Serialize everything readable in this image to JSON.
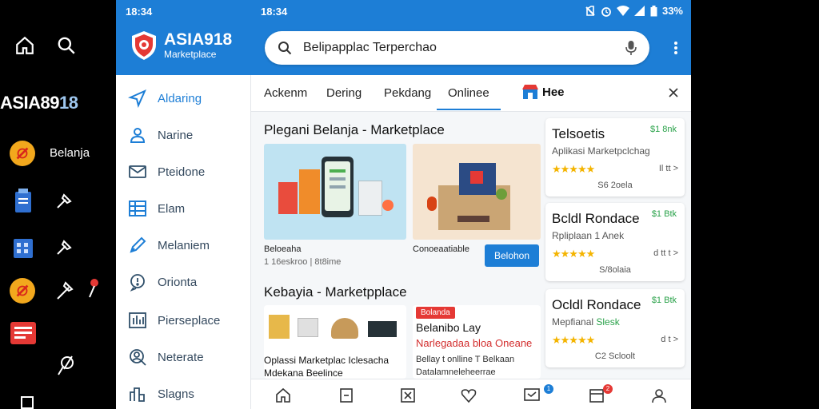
{
  "left_panel": {
    "logo_text_prefix": "ASIA89",
    "logo_text_num": "18",
    "belanja_label": "Belanja"
  },
  "statusbar": {
    "time_left": "18:34",
    "time_right": "18:34",
    "battery": "33%"
  },
  "brand": {
    "name": "ASIA918",
    "sub": "Marketplace"
  },
  "search": {
    "text": "Belipapplac Terperchao"
  },
  "sidebar": {
    "items": [
      {
        "label": "Aldaring",
        "icon": "send-icon"
      },
      {
        "label": "Narine",
        "icon": "user-icon"
      },
      {
        "label": "Pteidone",
        "icon": "mail-icon"
      },
      {
        "label": "Elam",
        "icon": "grid-icon"
      },
      {
        "label": "Melaniem",
        "icon": "pen-icon"
      },
      {
        "label": "Orionta",
        "icon": "chat-icon"
      },
      {
        "label": "Pierseplace",
        "icon": "bars-icon"
      },
      {
        "label": "Neterate",
        "icon": "search-user-icon"
      },
      {
        "label": "Slagns",
        "icon": "chart-icon"
      }
    ]
  },
  "tabs": {
    "items": [
      "Ackenm",
      "Dering",
      "Pekdang",
      "Onlinee"
    ],
    "active": "Onlinee",
    "store_label": "Hee"
  },
  "section1": {
    "title": "Plegani Belanja - Marketplace",
    "card1": {
      "name": "Beloeaha",
      "meta": "1 16eskroo | 8t8ime"
    },
    "card2": {
      "name": "Conoeaatiable",
      "button": "Belohon"
    }
  },
  "section2": {
    "title": "Kebayia - Marketpplace",
    "card1": {
      "line1": "Oplassi Marketplac Iclesacha",
      "line2": "Mdekana Beelince"
    },
    "card2": {
      "badge": "Bolanda",
      "title": "Belanibo Lay",
      "subtitle": "Narlegadaa bloa Oneane",
      "line1": "Bellay t onlline T Belkaan",
      "line2": "Datalamneleheerrae"
    }
  },
  "right_cards": [
    {
      "title": "Telsoetis",
      "price": "$1 8nk",
      "sub": "Aplikasi Marketpclchag",
      "extra": "Il tt >",
      "foot": "S6 2oela"
    },
    {
      "title": "Bcldl Rondace",
      "price": "$1 Btk",
      "sub": "Rpliplaan 1 Anek",
      "extra": "d tt t >",
      "foot": "S/8olaia"
    },
    {
      "title": "Ocldl Rondace",
      "price": "$1 Btk",
      "sub": "Mepfianal",
      "sub_highlight": "Slesk",
      "extra": "d t >",
      "foot": "C2 Scloolt"
    }
  ],
  "bottom_nav": {
    "badge_blue": "1",
    "badge_red": "2"
  },
  "colors": {
    "primary": "#1d7ed6",
    "accent_green": "#2aa24a",
    "star": "#f4b400",
    "badge_red": "#e53935"
  }
}
